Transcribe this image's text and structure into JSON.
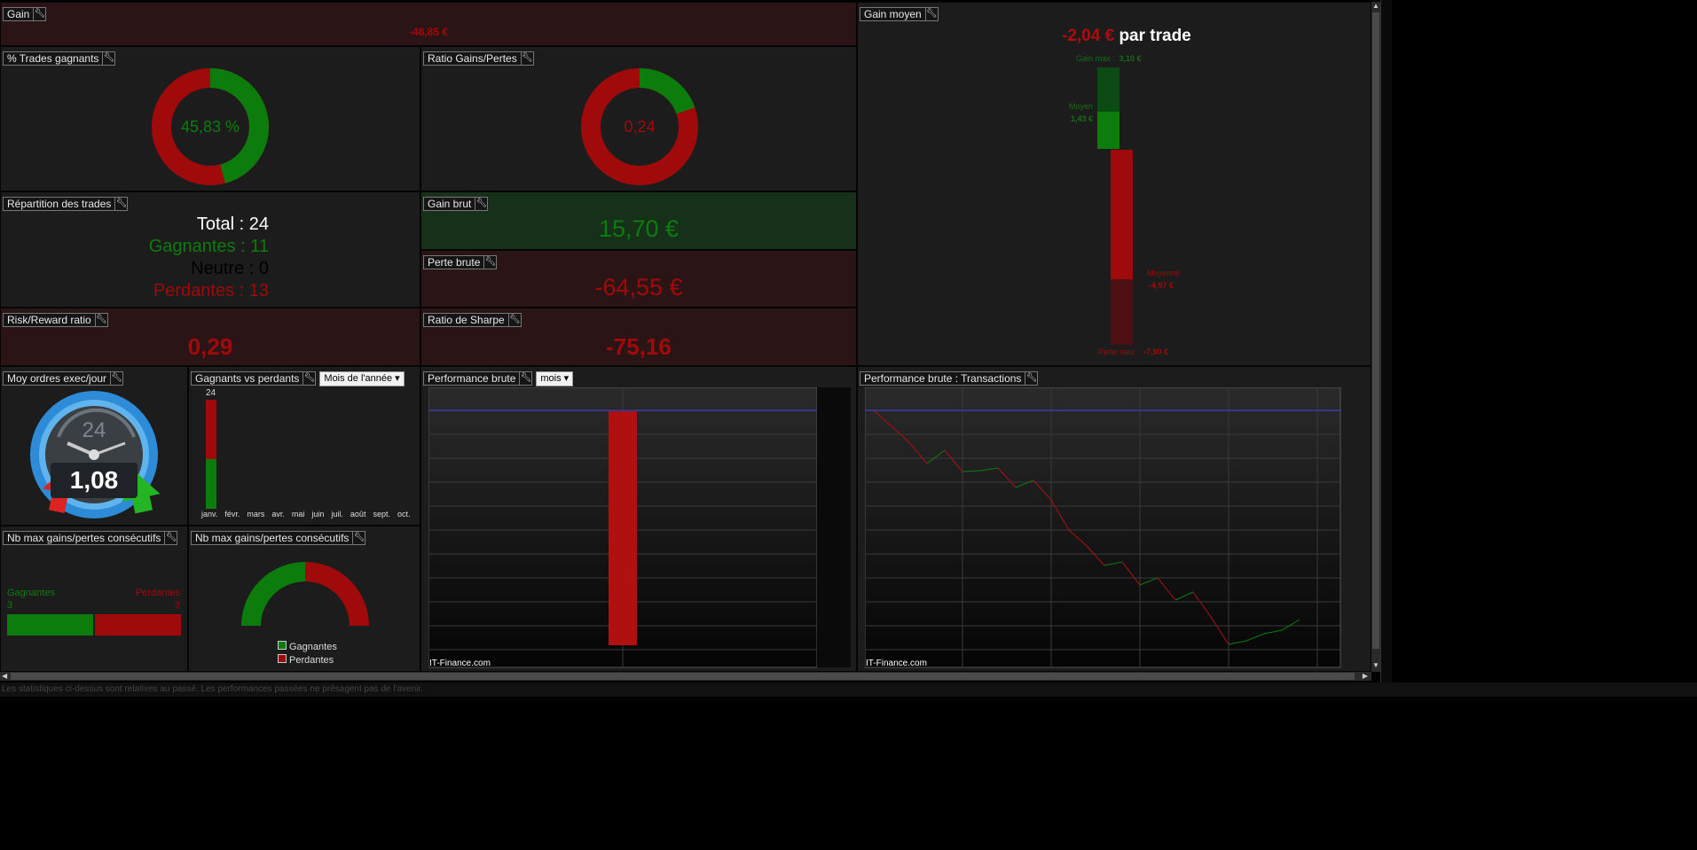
{
  "colors": {
    "green": "#0c7d0c",
    "red": "#a00a0a",
    "accent_blue": "#2d8bd8",
    "panel_bg": "#1c1c1c"
  },
  "gain": {
    "title": "Gain",
    "value": "-48,85 €"
  },
  "gain_moyen": {
    "title": "Gain moyen",
    "value": "-2,04 €",
    "suffix": "par trade",
    "gain_max_label": "Gain max :",
    "gain_max_value": "3,10 €",
    "moyen_label": "Moyen",
    "moyen_value": "1,43 €",
    "moyenne_label": "Moyenne",
    "moyenne_value": "-4,97 €",
    "perte_max_label": "Perte max :",
    "perte_max_value": "-7,90 €"
  },
  "trades_gagnants": {
    "title": "% Trades gagnants",
    "value": "45,83 %",
    "fraction": 0.4583
  },
  "ratio_gains_pertes": {
    "title": "Ratio Gains/Pertes",
    "value": "0,24",
    "fraction": 0.196
  },
  "repartition": {
    "title": "Répartition des trades",
    "total": "Total : 24",
    "gagnantes": "Gagnantes : 11",
    "neutre": "Neutre : 0",
    "perdantes": "Perdantes : 13"
  },
  "gain_brut": {
    "title": "Gain brut",
    "value": "15,70 €"
  },
  "perte_brute": {
    "title": "Perte brute",
    "value": "-64,55 €"
  },
  "risk_reward": {
    "title": "Risk/Reward ratio",
    "value": "0,29"
  },
  "sharpe": {
    "title": "Ratio de Sharpe",
    "value": "-75,16"
  },
  "moy_ordres": {
    "title": "Moy ordres exec/jour",
    "gauge_number": "24",
    "value": "1,08"
  },
  "gagnants_vs_perdants": {
    "title": "Gagnants vs perdants",
    "select": "Mois de l'année",
    "top_label": "24",
    "months": [
      "janv.",
      "févr.",
      "mars",
      "avr.",
      "mai",
      "juin",
      "juil.",
      "août",
      "sept.",
      "oct."
    ],
    "jan_winners": 11,
    "jan_losers": 13
  },
  "perf_brute": {
    "title": "Performance brute",
    "select": "mois",
    "watermark": "IT-Finance.com"
  },
  "perf_transactions": {
    "title": "Performance brute : Transactions",
    "watermark": "IT-Finance.com"
  },
  "consec_bar": {
    "title": "Nb max gains/pertes consécutifs",
    "gagnantes_label": "Gagnantes",
    "gagnantes_value": "3",
    "perdantes_label": "Perdantes",
    "perdantes_value": "3"
  },
  "consec_donut": {
    "title": "Nb max gains/pertes consécutifs",
    "legend_gagnantes": "Gagnantes",
    "legend_perdantes": "Perdantes",
    "gagnantes": 3,
    "perdantes": 3
  },
  "status_bar": {
    "text": "Les statistiques ci-dessus sont relatives au passé. Les performances passées ne présagent pas de l'avenir."
  }
}
